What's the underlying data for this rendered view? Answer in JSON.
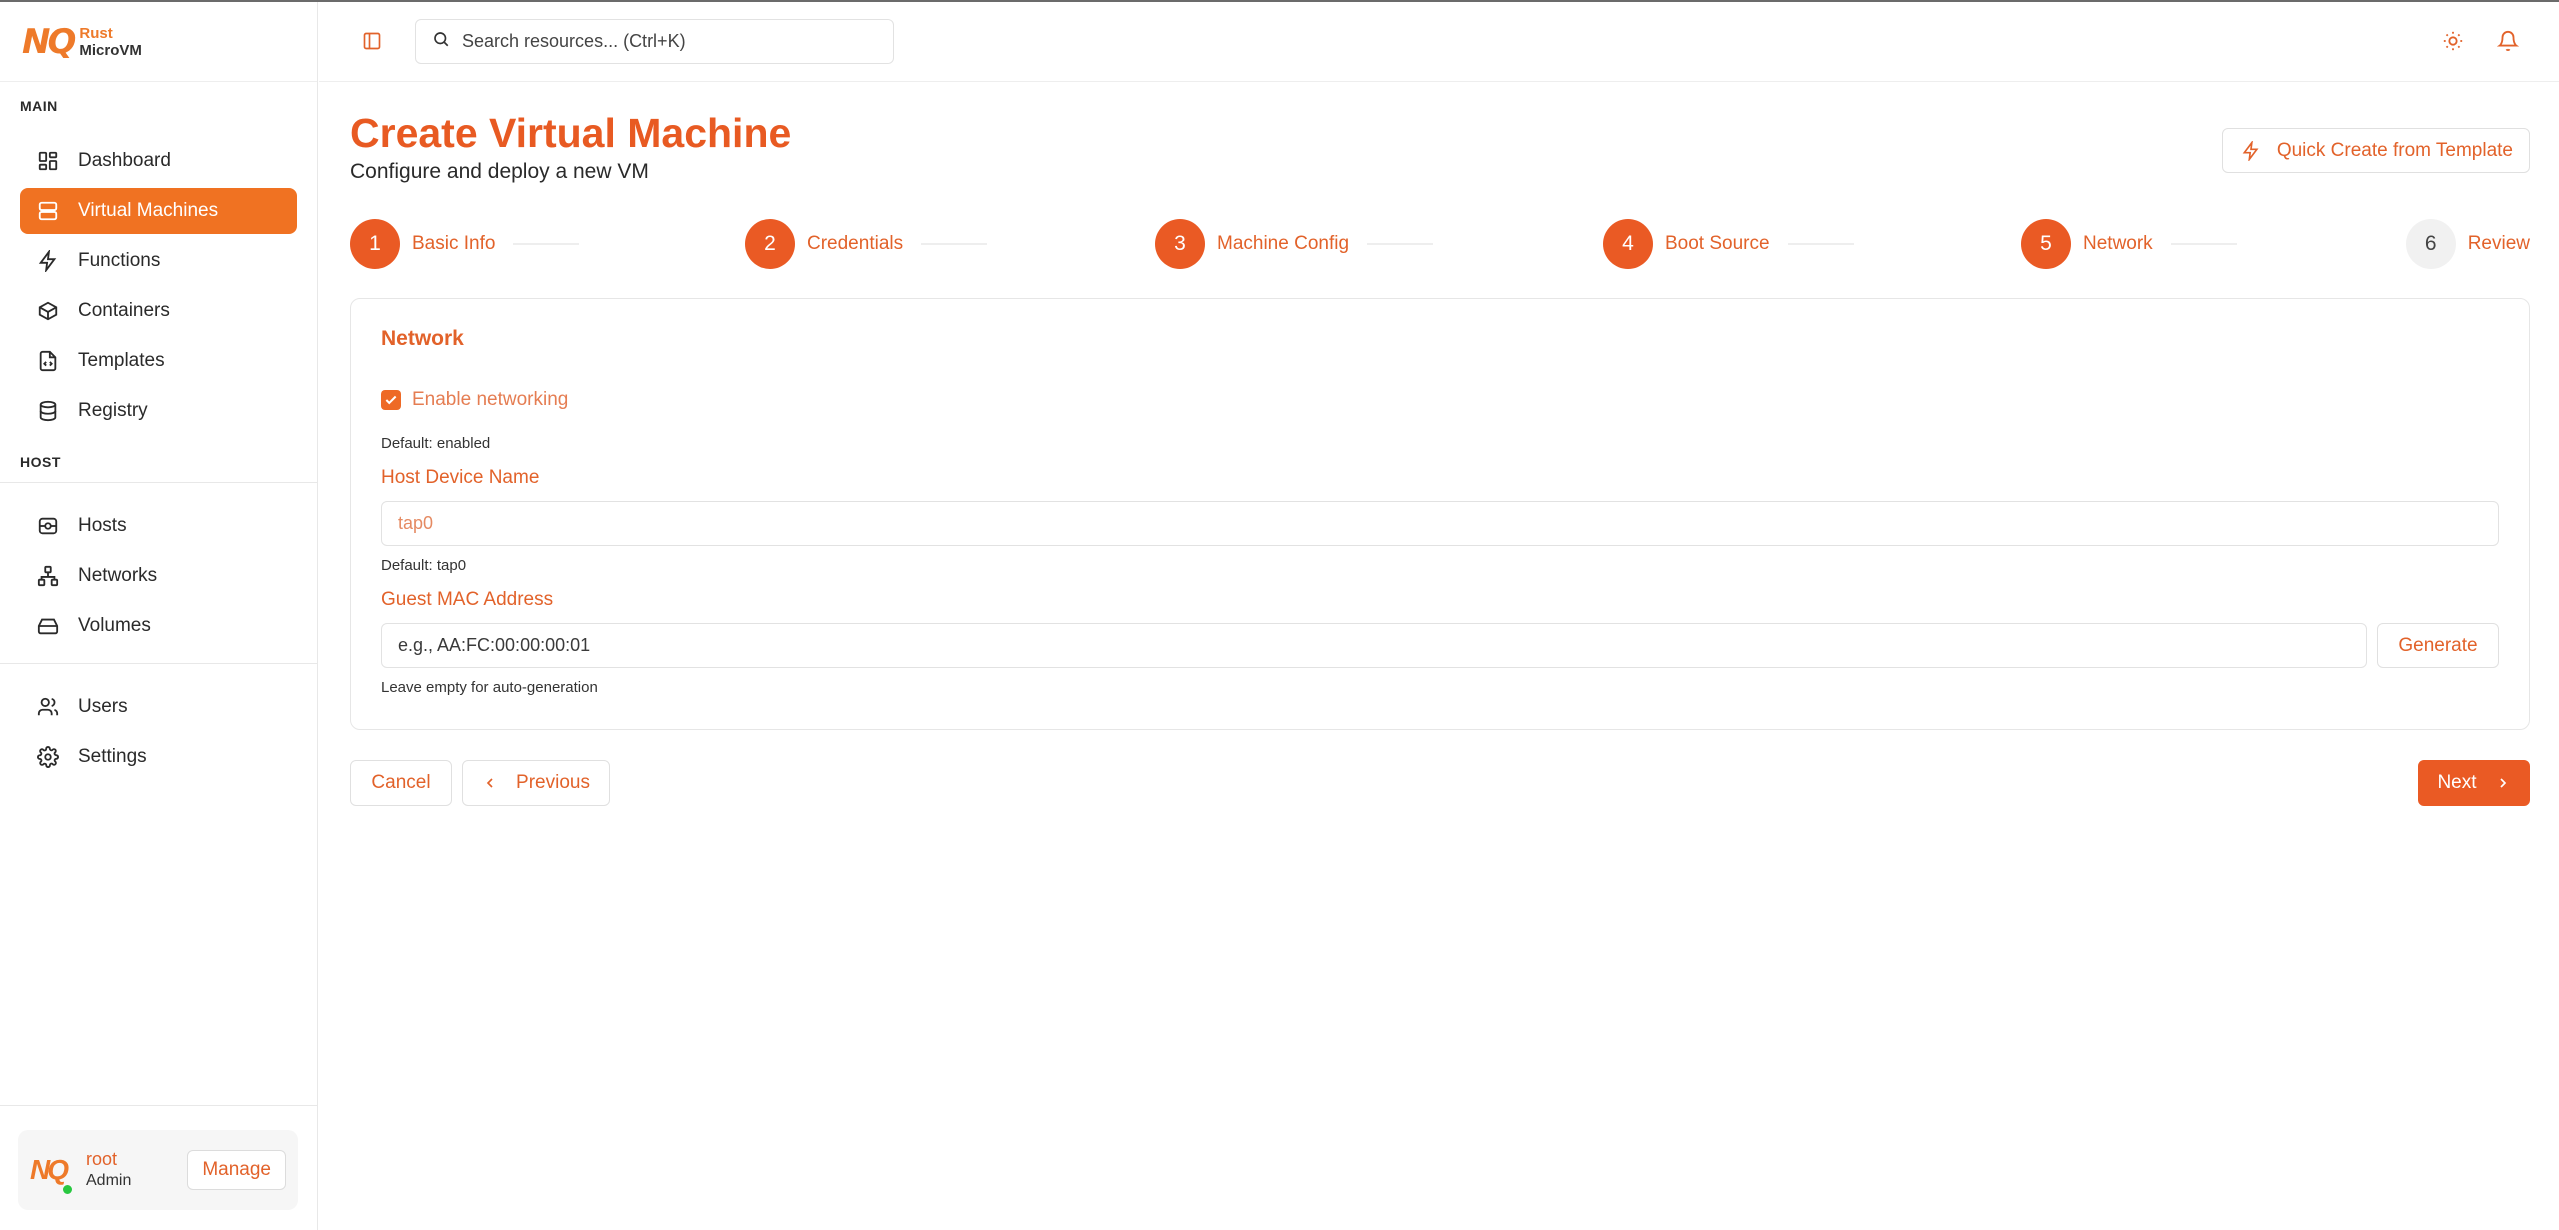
{
  "brand": {
    "mark": "NQ",
    "line1": "Rust",
    "line2": "MicroVM"
  },
  "sidebar": {
    "sections": [
      {
        "label": "MAIN",
        "items": [
          {
            "label": "Dashboard",
            "icon": "dashboard-grid-icon"
          },
          {
            "label": "Virtual Machines",
            "icon": "server-icon",
            "active": true
          },
          {
            "label": "Functions",
            "icon": "lightning-icon"
          },
          {
            "label": "Containers",
            "icon": "box-icon"
          },
          {
            "label": "Templates",
            "icon": "file-code-icon"
          },
          {
            "label": "Registry",
            "icon": "database-icon"
          }
        ]
      },
      {
        "label": "HOST",
        "items": [
          {
            "label": "Hosts",
            "icon": "host-icon"
          },
          {
            "label": "Networks",
            "icon": "network-icon"
          },
          {
            "label": "Volumes",
            "icon": "hard-drive-icon"
          }
        ]
      },
      {
        "label": "",
        "items": [
          {
            "label": "Users",
            "icon": "users-icon"
          },
          {
            "label": "Settings",
            "icon": "gear-icon"
          }
        ]
      }
    ],
    "user": {
      "name": "root",
      "role": "Admin",
      "manage_label": "Manage",
      "status_color": "#28c840"
    }
  },
  "topbar": {
    "search_placeholder": "Search resources... (Ctrl+K)",
    "icons": [
      "sidebar-toggle-icon",
      "search-icon",
      "sun-icon",
      "bell-icon"
    ]
  },
  "page": {
    "title": "Create Virtual Machine",
    "subtitle": "Configure and deploy a new VM",
    "quick_create_label": "Quick Create from Template"
  },
  "steps": [
    {
      "number": "1",
      "label": "Basic Info",
      "state": "done"
    },
    {
      "number": "2",
      "label": "Credentials",
      "state": "done"
    },
    {
      "number": "3",
      "label": "Machine Config",
      "state": "done"
    },
    {
      "number": "4",
      "label": "Boot Source",
      "state": "done"
    },
    {
      "number": "5",
      "label": "Network",
      "state": "current"
    },
    {
      "number": "6",
      "label": "Review",
      "state": "pending"
    }
  ],
  "network": {
    "title": "Network",
    "enable_label": "Enable networking",
    "enable_checked": true,
    "enable_hint": "Default: enabled",
    "host_device_label": "Host Device Name",
    "host_device_placeholder": "tap0",
    "host_device_hint": "Default: tap0",
    "mac_label": "Guest MAC Address",
    "mac_placeholder": "e.g., AA:FC:00:00:00:01",
    "mac_hint": "Leave empty for auto-generation",
    "generate_label": "Generate"
  },
  "actions": {
    "cancel": "Cancel",
    "previous": "Previous",
    "next": "Next"
  },
  "colors": {
    "accent": "#ea5a24",
    "active_nav": "#f07222",
    "text_accent": "#e2622a"
  }
}
